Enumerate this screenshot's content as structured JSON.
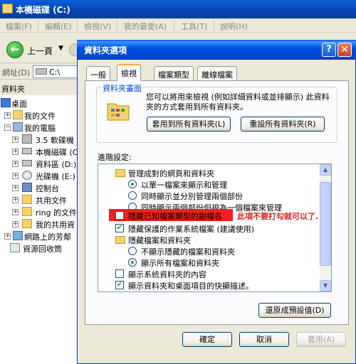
{
  "explorer": {
    "title": "本機磁碟 (C:)",
    "menu": [
      "檔案(F)",
      "編輯(E)",
      "檢視(V)",
      "我的最愛(A)",
      "工具(T)",
      "說明(H)"
    ],
    "back_label": "上一頁",
    "address_label": "網址(D)",
    "address_value": "C:\\",
    "tree_header": "資料夾",
    "tree": [
      {
        "label": "桌面"
      },
      {
        "label": "我的文件"
      },
      {
        "label": "我的電腦"
      },
      {
        "label": "3.5 軟碟機"
      },
      {
        "label": "本機磁碟 (C"
      },
      {
        "label": "資料區 (D:)"
      },
      {
        "label": "光碟機 (E:)"
      },
      {
        "label": "控制台"
      },
      {
        "label": "共用文件"
      },
      {
        "label": "ring 的文件"
      },
      {
        "label": "我的共用資"
      },
      {
        "label": "網路上的芳鄰"
      },
      {
        "label": "資源回收筒"
      }
    ]
  },
  "dialog": {
    "title": "資料夾選項",
    "tabs": [
      "一般",
      "檢視",
      "檔案類型",
      "離線檔案"
    ],
    "group_title": "資料夾畫面",
    "group_desc": "您可以將用來檢視 (例如詳細資料或並排顯示) 此資料夾的方式套用到所有資料夾。",
    "apply_all_btn": "套用到所有資料夾(L)",
    "reset_all_btn": "重設所有資料夾(R)",
    "advanced_label": "進階設定:",
    "settings": [
      {
        "label": "管理成對的網頁和資料夾",
        "kind": "folder"
      },
      {
        "label": "以單一檔案來顯示和管理",
        "kind": "radio",
        "checked": true
      },
      {
        "label": "同時顯示並分別管理兩個部份",
        "kind": "radio",
        "checked": false
      },
      {
        "label": "同時顯示兩個部份但視為一個檔案來管理",
        "kind": "radio",
        "checked": false
      },
      {
        "label": "隱藏已知檔案類型的副檔名",
        "kind": "checkbox",
        "checked": false
      },
      {
        "label": "隱藏保護的作業系統檔案 (建議使用)",
        "kind": "checkbox",
        "checked": true
      },
      {
        "label": "隱藏檔案和資料夾",
        "kind": "folder"
      },
      {
        "label": "不顯示隱藏的檔案和資料夾",
        "kind": "radio",
        "checked": false
      },
      {
        "label": "顯示所有檔案和資料夾",
        "kind": "radio",
        "checked": true
      },
      {
        "label": "顯示系統資料夾的內容",
        "kind": "checkbox",
        "checked": false
      },
      {
        "label": "顯示資料夾和桌面項目的快顯描述。",
        "kind": "checkbox",
        "checked": true
      }
    ],
    "annotation": "此項不要打勾就可以了.",
    "restore_btn": "還原成預設值(D)",
    "ok_btn": "確定",
    "cancel_btn": "取消",
    "apply_btn": "套用(A)",
    "help_btn": "?",
    "close_btn": "✕",
    "checkmark": "✔"
  }
}
